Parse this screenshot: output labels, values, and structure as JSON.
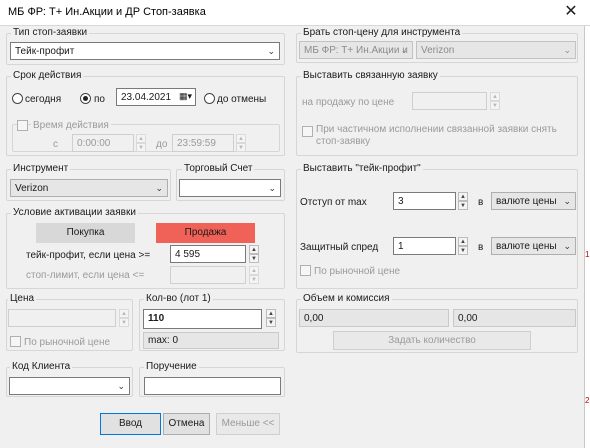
{
  "window": {
    "title": "МБ ФР: Т+ Ин.Акции и ДР Стоп-заявка"
  },
  "order_type": {
    "label": "Тип стоп-заявки",
    "value": "Тейк-профит"
  },
  "expiry": {
    "label": "Срок действия",
    "today": "сегодня",
    "until": "по",
    "date": "23.04.2021",
    "until_cancel": "до отмены",
    "time_label": "Время действия",
    "from": "с",
    "time_from": "0:00:00",
    "to": "до",
    "time_to": "23:59:59"
  },
  "instrument": {
    "label": "Инструмент",
    "value": "Verizon"
  },
  "account": {
    "label": "Торговый Счет",
    "value": ""
  },
  "activation": {
    "label": "Условие активации заявки",
    "buy": "Покупка",
    "sell": "Продажа",
    "tp_label": "тейк-профит, если цена >=",
    "tp_value": "4 595",
    "sl_label": "стоп-лимит, если цена <=",
    "sl_value": ""
  },
  "price": {
    "label": "Цена",
    "value": "",
    "market": "По рыночной цене"
  },
  "qty": {
    "label": "Кол-во (лот 1)",
    "value": "110",
    "max": "max: 0"
  },
  "client": {
    "label": "Код Клиента",
    "value": ""
  },
  "comment": {
    "label": "Поручение",
    "value": ""
  },
  "right": {
    "stop_price_label": "Брать стоп-цену для инструмента",
    "stop_price_class": "МБ ФР: Т+ Ин.Акции и",
    "stop_price_instrument": "Verizon",
    "linked_label": "Выставить связанную заявку",
    "linked_sell_label": "на продажу по цене",
    "linked_partial": "При частичном исполнении связанной заявки снять стоп-заявку",
    "tp_group": "Выставить \"тейк-профит\"",
    "offset_label": "Отступ от max",
    "offset_value": "3",
    "in": "в",
    "offset_unit": "валюте цены",
    "spread_label": "Защитный спред",
    "spread_value": "1",
    "spread_unit": "валюте цены",
    "market_label": "По рыночной цене",
    "vol_label": "Объем и комиссия",
    "vol1": "0,00",
    "vol2": "0,00",
    "set_qty": "Задать количество"
  },
  "footer": {
    "enter": "Ввод",
    "cancel": "Отмена",
    "less": "Меньше <<"
  },
  "side_marks": [
    "1",
    "2"
  ],
  "colors": {
    "sell": "#f06158",
    "focus": "#0078d7"
  }
}
